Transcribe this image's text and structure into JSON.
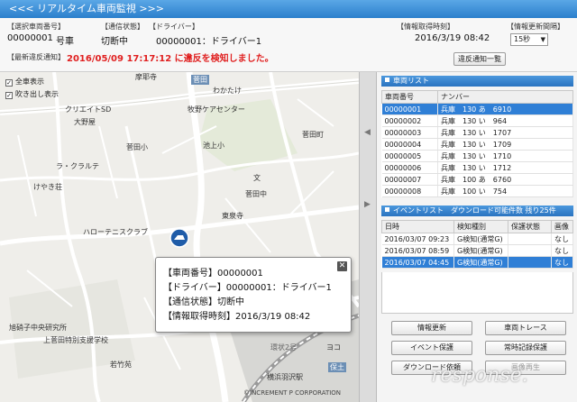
{
  "window": {
    "title": "<<< リアルタイム車両監視 >>>"
  },
  "info": {
    "vehicle_no_label": "【選択車両番号】",
    "vehicle_no": "00000001",
    "vehicle_suffix": "号車",
    "comm_label": "【通信状態】",
    "comm_value": "切断中",
    "driver_label": "【ドライバー】",
    "driver_value": "00000001：ドライバー1",
    "acq_label": "【情報取得時刻】",
    "acq_value": "2016/3/19 08:42",
    "interval_label": "【情報更新間隔】",
    "interval_value": "15秒",
    "alert_label": "【最新違反通知】",
    "alert_value": "2016/05/09 17:17:12 に違反を検知しました。",
    "alert_list_button": "違反通知一覧",
    "alert_color": "#e02020"
  },
  "map": {
    "show_all": "全車表示",
    "show_balloon": "吹き出し表示",
    "places": {
      "p1": "摩耶寺",
      "p2": "菅田",
      "p3": "わかたけ",
      "p4": "クリエイトSD",
      "p5": "大野屋",
      "p6": "牧野ケアセンター",
      "p7": "菅田町",
      "p8": "菅田小",
      "p9": "池上小",
      "p10": "ラ・クラルテ",
      "p11": "けやき荘",
      "p12": "文",
      "p13": "菅田中",
      "p14": "東泉寺",
      "p15": "ハローテニスクラブ",
      "p16": "旭硝子中央研究所",
      "p17": "上菅田特別支援学校",
      "p18": "若竹苑",
      "p19": "横浜羽沢駅",
      "p20": "保土",
      "p21": "ヨコ",
      "p22": "環状2号",
      "copyright": "©INCREMENT P CORPORATION"
    },
    "popup": {
      "line1": "【車両番号】00000001",
      "line2": "【ドライバー】00000001：ドライバー1",
      "line3": "【通信状態】切断中",
      "line4": "【情報取得時刻】2016/3/19 08:42"
    }
  },
  "vehicle_list": {
    "title": "車両リスト",
    "headers": [
      "車両番号",
      "ナンバー"
    ],
    "rows": [
      [
        "00000001",
        "兵庫　130 あ　6910"
      ],
      [
        "00000002",
        "兵庫　130 い　964"
      ],
      [
        "00000003",
        "兵庫　130 い　1707"
      ],
      [
        "00000004",
        "兵庫　130 い　1709"
      ],
      [
        "00000005",
        "兵庫　130 い　1710"
      ],
      [
        "00000006",
        "兵庫　130 い　1712"
      ],
      [
        "00000007",
        "兵庫　100 あ　6760"
      ],
      [
        "00000008",
        "兵庫　100 い　754"
      ]
    ]
  },
  "event_list": {
    "title": "イベントリスト　ダウンロード可能件数 残り25件",
    "headers": [
      "日時",
      "検知種別",
      "保護状態",
      "画像"
    ],
    "rows": [
      [
        "2016/03/07 09:23",
        "G検知(通常G)",
        "",
        "なし"
      ],
      [
        "2016/03/07 08:59",
        "G検知(通常G)",
        "",
        "なし"
      ],
      [
        "2016/03/07 04:45",
        "G検知(通常G)",
        "",
        "なし"
      ]
    ]
  },
  "buttons": {
    "info_update": "情報更新",
    "vehicle_trace": "車両トレース",
    "event_protect": "イベント保護",
    "constant_protect": "常時記録保護",
    "download_request": "ダウンロード依頼",
    "video_play": "画像再生"
  },
  "watermark": "response."
}
